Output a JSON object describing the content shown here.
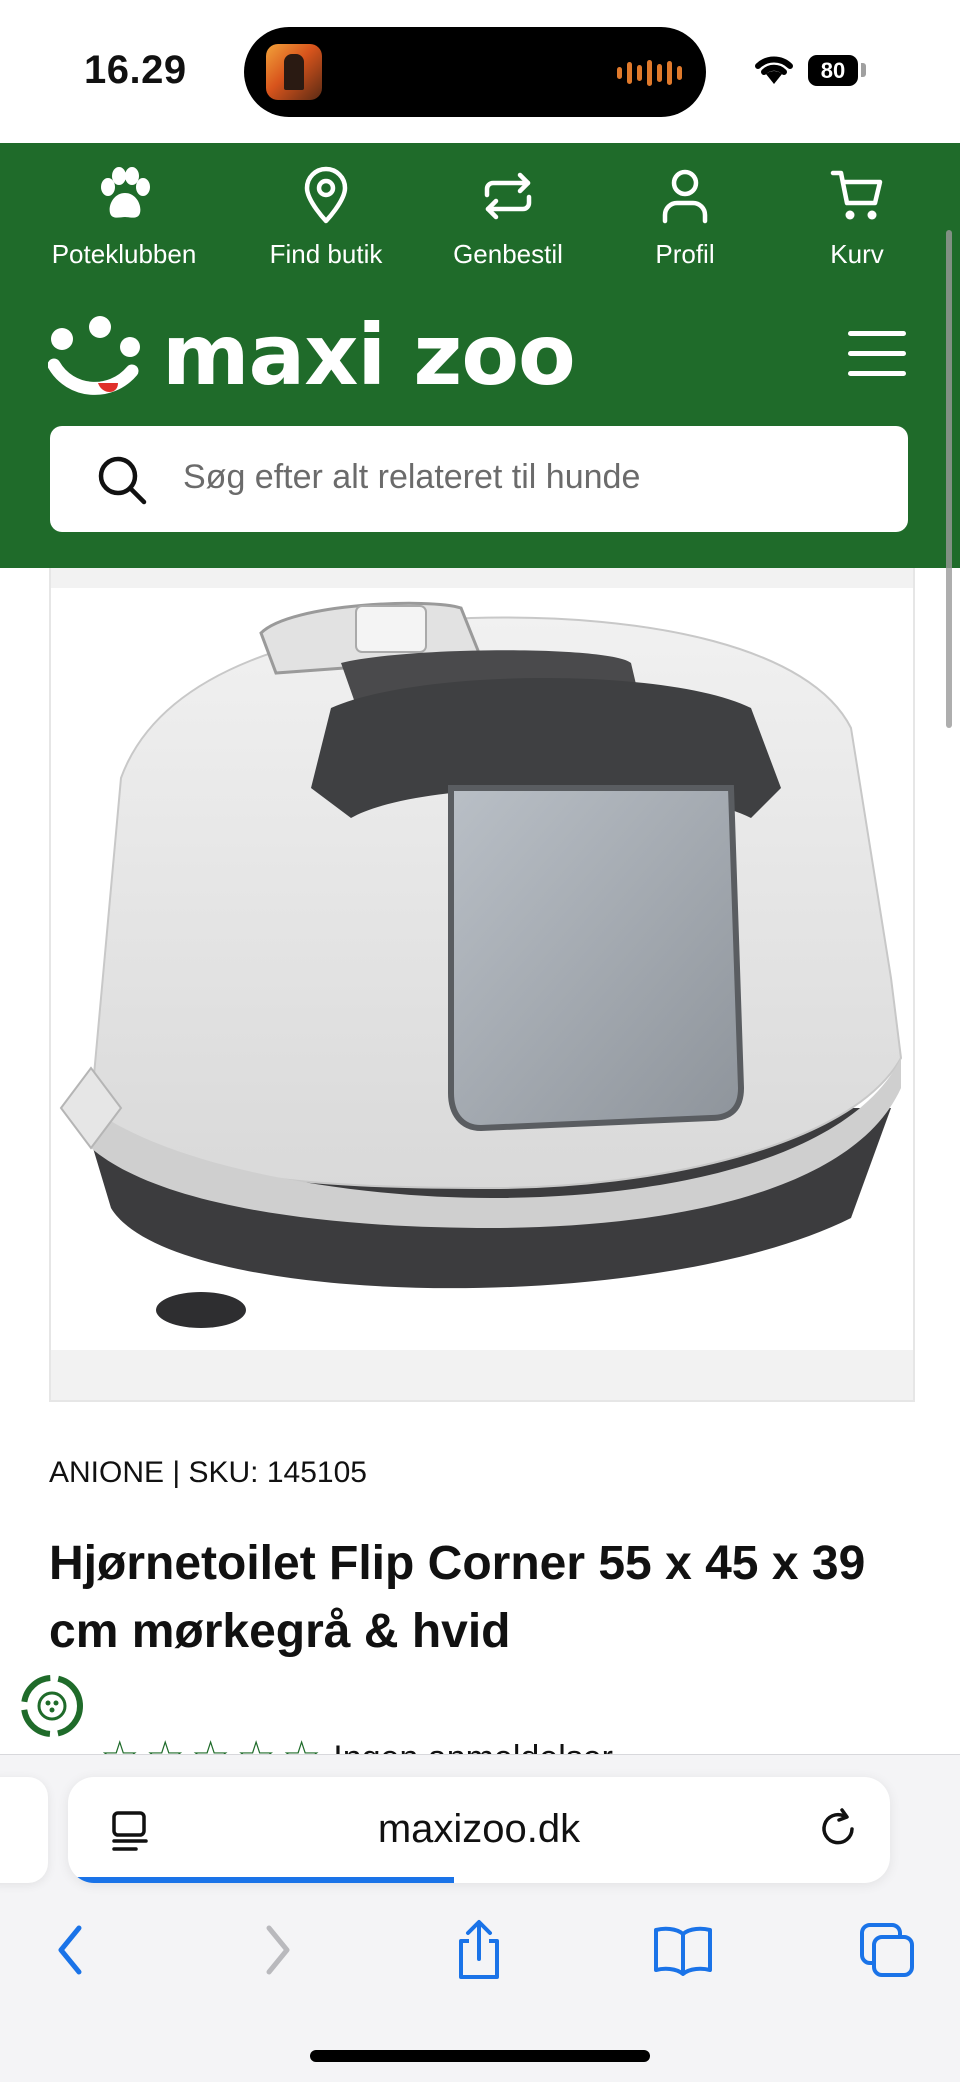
{
  "status_bar": {
    "time": "16.29",
    "battery": "80"
  },
  "header": {
    "nav": [
      {
        "label": "Poteklubben",
        "icon": "paw-icon"
      },
      {
        "label": "Find butik",
        "icon": "location-pin-icon"
      },
      {
        "label": "Genbestil",
        "icon": "repeat-icon"
      },
      {
        "label": "Profil",
        "icon": "user-icon"
      },
      {
        "label": "Kurv",
        "icon": "cart-icon"
      }
    ],
    "logo_text": "maxi zoo",
    "search_placeholder": "Søg efter alt relateret til hunde",
    "brand_color": "#1f6b2a"
  },
  "product": {
    "brand_sku": "ANIONE | SKU: 145105",
    "title": "Hjørnetoilet Flip Corner 55 x 45 x 39 cm mørkegrå & hvid",
    "rating_stars": 0,
    "reviews_text": "Ingen anmeldelser"
  },
  "browser": {
    "url": "maxizoo.dk",
    "load_progress": 0.47,
    "accent_color": "#1a73e8"
  }
}
